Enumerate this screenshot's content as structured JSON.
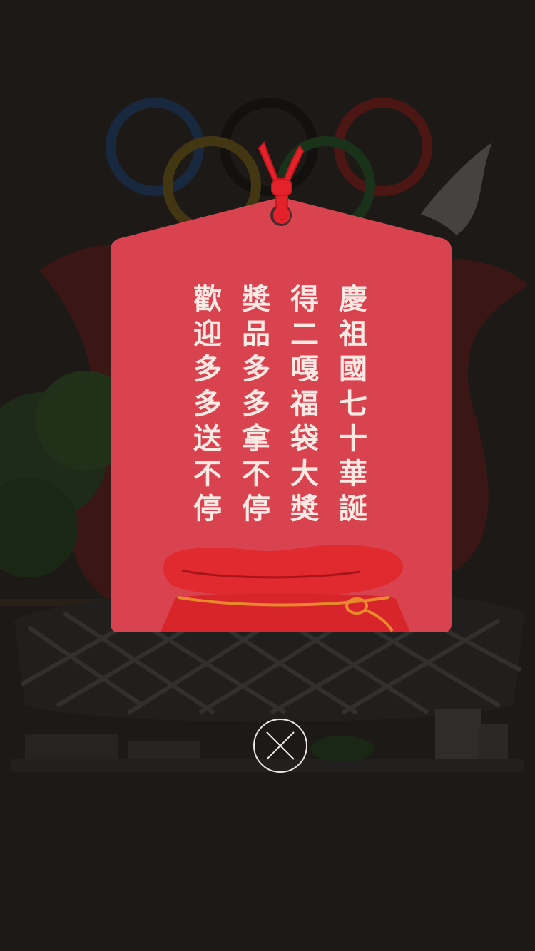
{
  "card": {
    "columns": [
      "慶祖國七十華誕",
      "得二嘎福袋大獎",
      "獎品多多拿不停",
      "歡迎多多送不停"
    ]
  },
  "colors": {
    "background": "#23201c",
    "card_red": "#d9434f",
    "text": "#fbe9e4"
  },
  "close_button": {
    "icon": "close-icon"
  }
}
